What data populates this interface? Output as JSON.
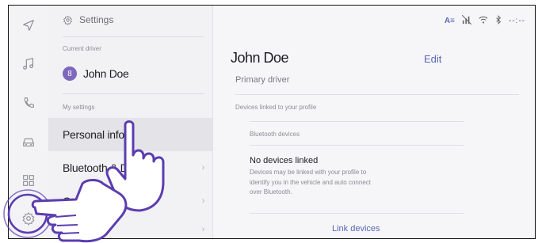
{
  "header": {
    "title": "Settings"
  },
  "status_bar": {
    "accent_text": "A≡",
    "time": "--:--"
  },
  "rail": {
    "icons": [
      "navigation-icon",
      "music-icon",
      "phone-icon",
      "car-icon",
      "apps-icon",
      "settings-icon"
    ]
  },
  "sidebar": {
    "current_driver_label": "Current driver",
    "avatar_initial": "8",
    "driver_name": "John Doe",
    "my_settings_label": "My settings",
    "items": [
      {
        "label": "Personal info",
        "chevron": ""
      },
      {
        "label": "Bluetooth & D",
        "chevron": "›"
      },
      {
        "label": "C",
        "chevron": "›"
      },
      {
        "label": "Wi",
        "chevron": "›"
      }
    ]
  },
  "detail": {
    "name": "John Doe",
    "role": "Primary driver",
    "edit_label": "Edit",
    "linked_section_label": "Devices linked to your profile",
    "bluetooth_label": "Bluetooth devices",
    "empty_title": "No devices linked",
    "empty_text": "Devices may be linked with your profile to identify you in the vehicle and auto connect over Bluetooth.",
    "link_button": "Link devices"
  },
  "colors": {
    "accent": "#5a67b3",
    "avatar": "#7e67bd",
    "selected_row": "#e3e3e8"
  }
}
